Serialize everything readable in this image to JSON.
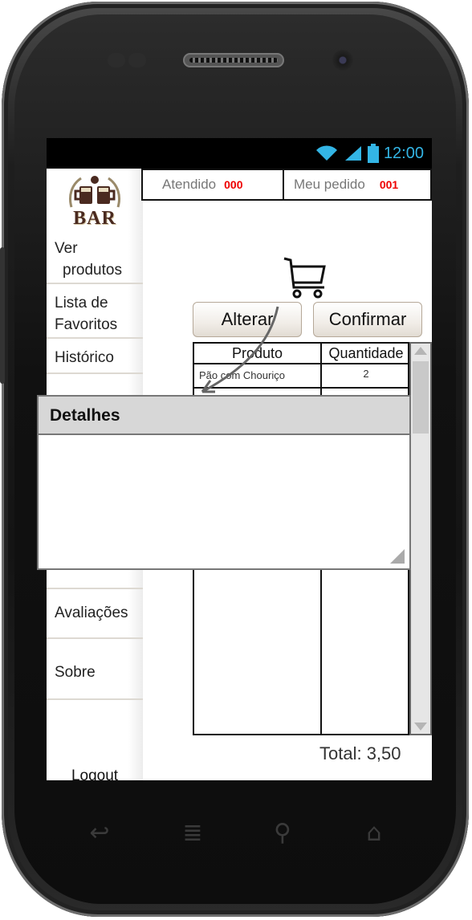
{
  "status_bar": {
    "time": "12:00"
  },
  "sidebar": {
    "logo_text": "BAR",
    "items": [
      {
        "line1": "Ver",
        "line2": "produtos"
      },
      {
        "line1": "Lista de",
        "line2": "Favoritos"
      },
      {
        "line1": "Histórico"
      },
      {
        "line1": "Avaliações"
      },
      {
        "line1": "Sobre"
      }
    ],
    "logout_label": "Logout"
  },
  "header": {
    "attended_label": "Atendido",
    "attended_number": "000",
    "order_label": "Meu pedido",
    "order_number": "001"
  },
  "actions": {
    "alter_label": "Alterar",
    "confirm_label": "Confirmar"
  },
  "table": {
    "columns": [
      "Produto",
      "Quantidade"
    ],
    "rows": [
      {
        "product": "Pão com Chouriço",
        "quantity": "2"
      }
    ]
  },
  "total_label": "Total: 3,50",
  "dialog": {
    "title": "Detalhes"
  }
}
